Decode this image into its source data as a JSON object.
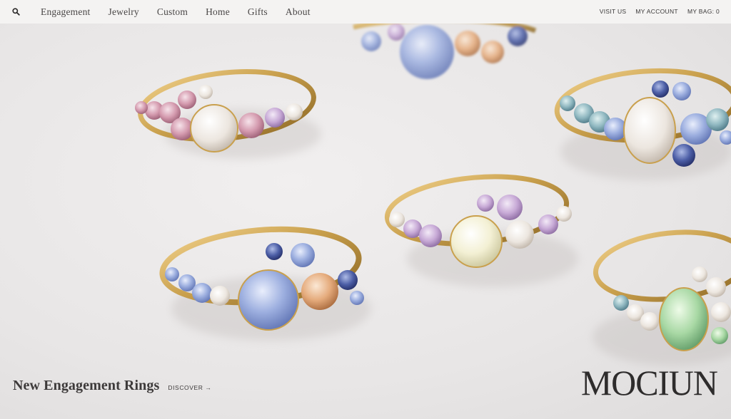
{
  "topbar": {
    "search_icon": "search-icon",
    "primary_nav": [
      {
        "label": "Engagement"
      },
      {
        "label": "Jewelry"
      },
      {
        "label": "Custom"
      },
      {
        "label": "Home"
      },
      {
        "label": "Gifts"
      },
      {
        "label": "About"
      }
    ],
    "secondary_nav": [
      {
        "label": "VISIT US"
      },
      {
        "label": "MY ACCOUNT"
      },
      {
        "label": "MY BAG: 0"
      }
    ]
  },
  "hero": {
    "title": "New Engagement Rings",
    "cta": "DISCOVER →",
    "brand": "MOCIUN",
    "image_subject": "rings",
    "colors": {
      "background": "#eceaea",
      "gold": "#c9a04d",
      "text": "#3d3a3a"
    }
  }
}
